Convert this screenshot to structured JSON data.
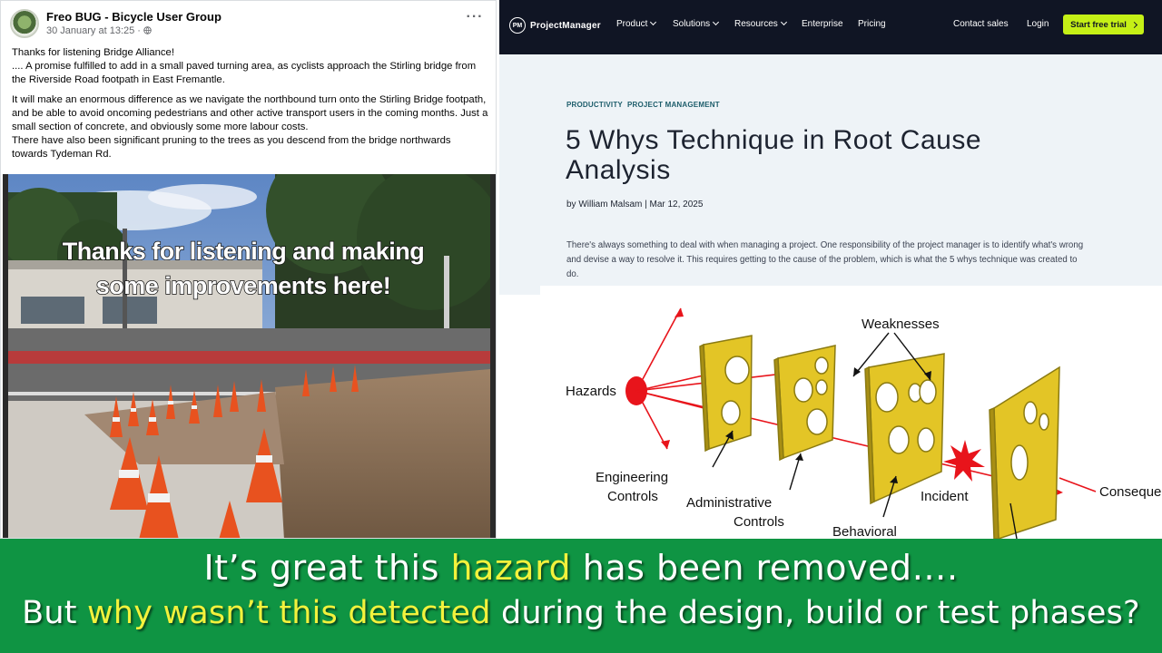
{
  "facebook_post": {
    "group_name": "Freo BUG - Bicycle User Group",
    "date": "30 January at 13:25 · ",
    "privacy_icon": "globe-icon",
    "more_icon": "more-options-icon",
    "paragraphs": [
      "Thanks for listening Bridge Alliance!\n.... A promise fulfilled to add in a small paved turning area, as cyclists approach the Stirling bridge from the Riverside Road footpath in East Fremantle.",
      "It will make an enormous difference as we navigate the northbound turn onto the Stirling Bridge footpath, and be able to avoid oncoming pedestrians and other active transport users in the coming months. Just a small section of concrete, and obviously some more labour costs.",
      "There have also been significant pruning to the trees as you descend from the bridge northwards towards Tydeman Rd."
    ],
    "photo_caption_line1": "Thanks for listening and making",
    "photo_caption_line2": "some improvements here!"
  },
  "project_manager": {
    "logo_mark": "PM",
    "logo_text": "ProjectManager",
    "nav": {
      "product": "Product",
      "solutions": "Solutions",
      "resources": "Resources",
      "enterprise": "Enterprise",
      "pricing": "Pricing",
      "contact_sales": "Contact sales",
      "login": "Login",
      "cta": "Start free trial"
    },
    "tags": [
      "PRODUCTIVITY",
      "PROJECT MANAGEMENT"
    ],
    "title_line1": "5 Whys Technique in Root Cause",
    "title_line2": "Analysis",
    "byline": "by William Malsam | Mar 12, 2025",
    "intro": "There's always something to deal with when managing a project. One responsibility of the project manager is to identify what's wrong and devise a way to resolve it. This requires getting to the cause of the problem, which is what the 5 whys technique was created to do.",
    "diagram": {
      "hazards": "Hazards",
      "weaknesses": "Weaknesses",
      "engineering_1": "Engineering",
      "engineering_2": "Controls",
      "administrative_1": "Administrative",
      "administrative_2": "Controls",
      "behavioral": "Behavioral",
      "incident": "Incident",
      "consequences": "Consequences"
    }
  },
  "banner": {
    "line1_pre": "It’s great this ",
    "line1_hl": "hazard",
    "line1_post": " has been removed….",
    "line2_pre": "But ",
    "line2_hl": "why wasn’t this detected",
    "line2_post": " during the design, build or test phases?",
    "highlight_color": "#f2f23c",
    "background_color": "#0f9443"
  }
}
